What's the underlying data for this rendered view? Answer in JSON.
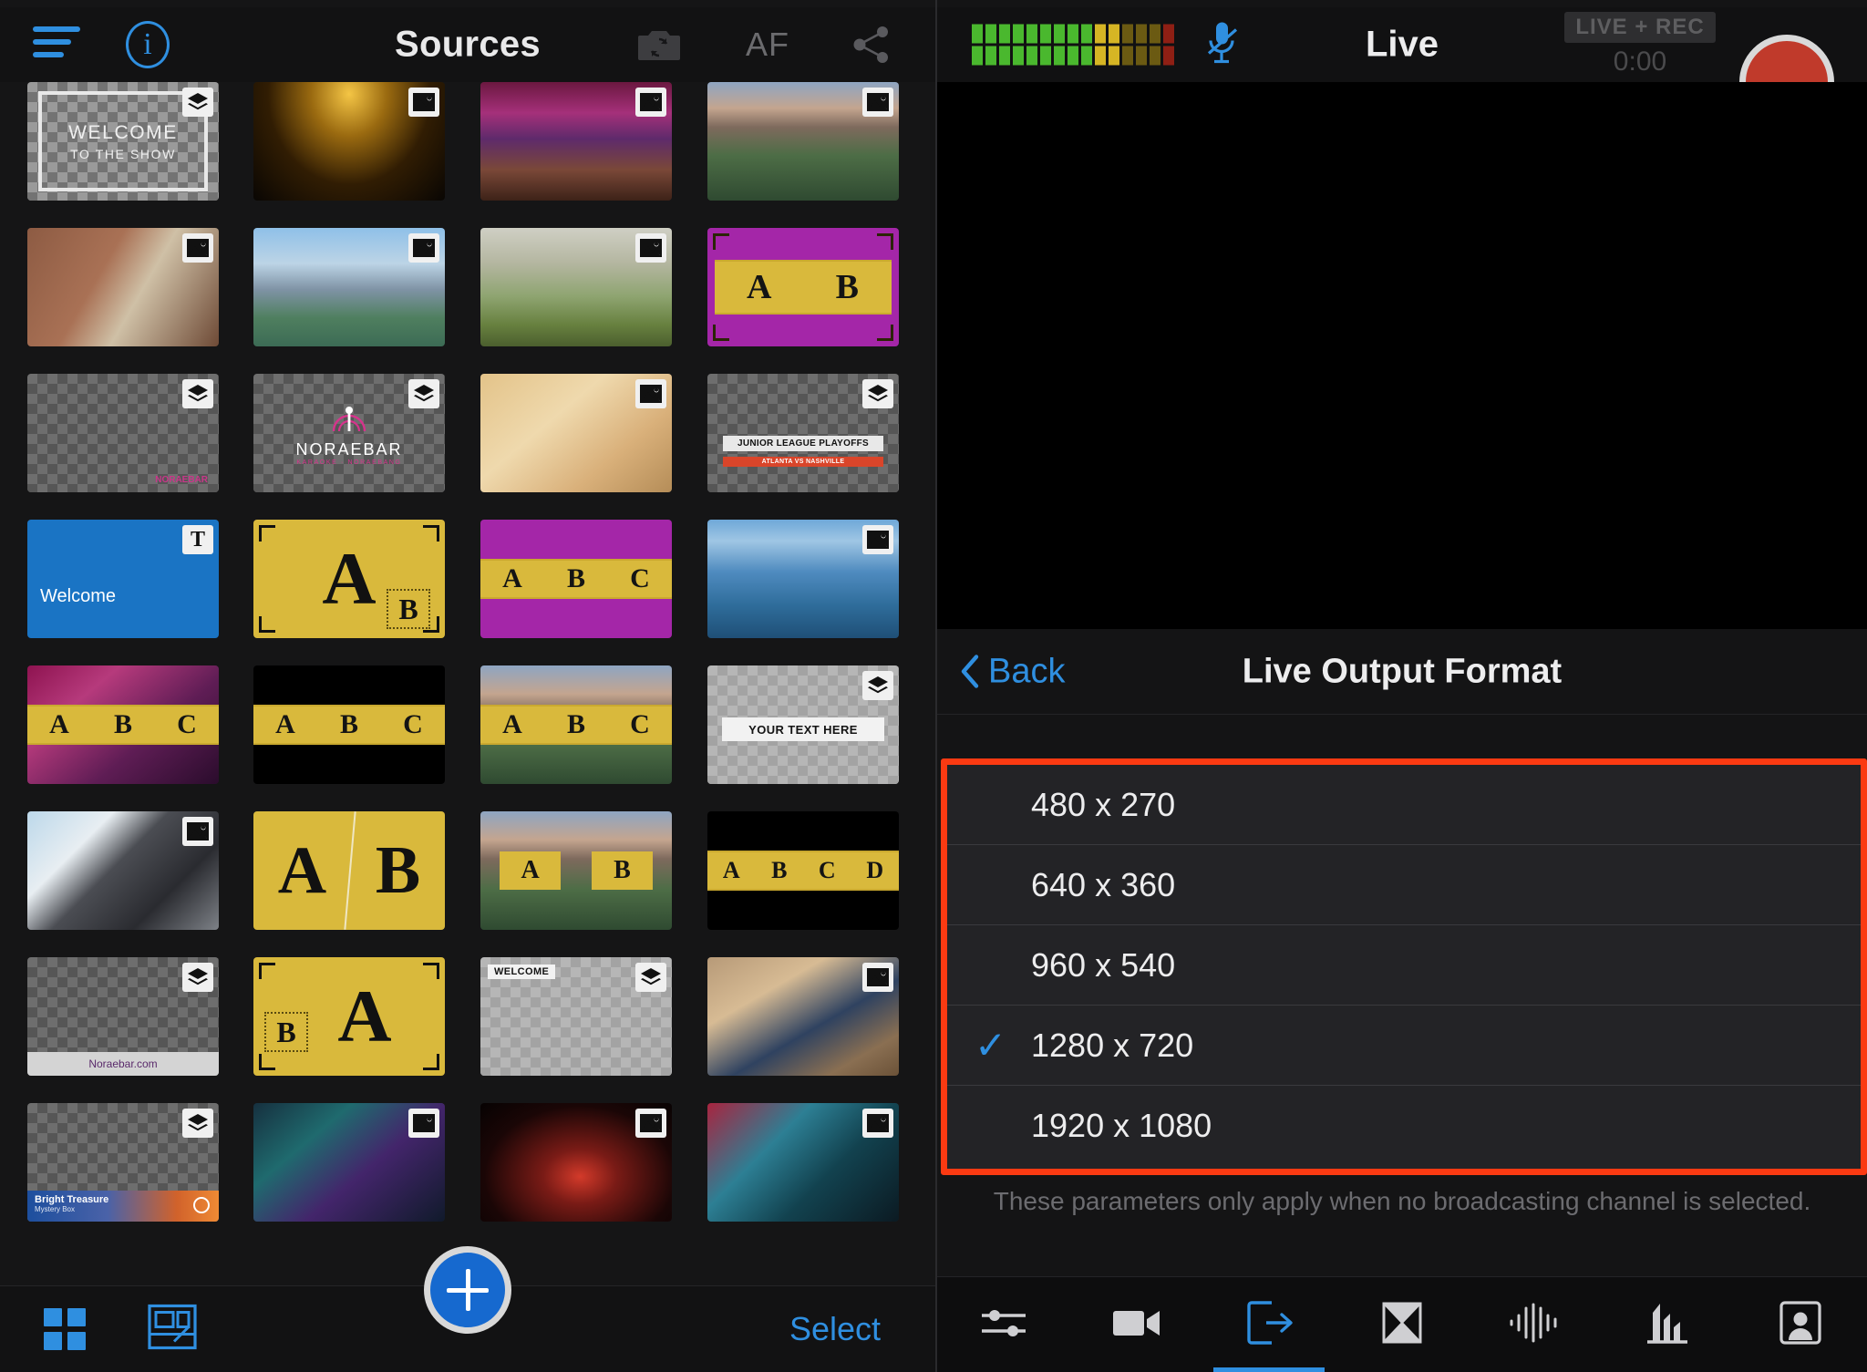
{
  "left": {
    "topbar": {
      "title": "Sources",
      "menu_icon": "hamburger-icon",
      "info_icon": "info-icon",
      "info_glyph": "i",
      "flip_camera_icon": "flip-camera-icon",
      "af_label": "AF",
      "share_icon": "share-icon"
    },
    "bottombar": {
      "grid_view_icon": "grid-view-icon",
      "layout_view_icon": "layout-view-icon",
      "add_icon": "plus-icon",
      "select_label": "Select"
    },
    "grid": {
      "rows": [
        [
          {
            "name": "welcome-to-the-show",
            "badge": "layers",
            "kind": "checker-frame",
            "line1": "WELCOME",
            "line2": "TO THE SHOW"
          },
          {
            "name": "concert-gold",
            "badge": "image",
            "kind": "photo",
            "fill": "ph-concert-gold"
          },
          {
            "name": "crowd-purple",
            "badge": "image",
            "kind": "photo",
            "fill": "ph-crowd"
          },
          {
            "name": "austin-skyline",
            "badge": "image",
            "kind": "photo",
            "fill": "ph-skyline-austin"
          }
        ],
        [
          {
            "name": "brick-building",
            "badge": "image",
            "kind": "photo",
            "fill": "ph-brick"
          },
          {
            "name": "city-river",
            "badge": "image",
            "kind": "photo",
            "fill": "ph-skyline-blue"
          },
          {
            "name": "marsh-landscape",
            "badge": "image",
            "kind": "photo",
            "fill": "ph-marsh"
          },
          {
            "name": "ab-split-purple",
            "badge": "none",
            "kind": "ab2",
            "bg": "#a426a8",
            "letters": [
              "A",
              "B"
            ]
          }
        ],
        [
          {
            "name": "noraebar-watermark",
            "badge": "layers",
            "kind": "checker-plain",
            "caption": "NORAEBAR"
          },
          {
            "name": "noraebar-logo",
            "badge": "layers",
            "kind": "checker-logo",
            "caption": "NORAEBAR",
            "sub": "KARAOKE · NORAEBANG"
          },
          {
            "name": "hummus-dish",
            "badge": "image",
            "kind": "photo",
            "fill": "ph-hummus"
          },
          {
            "name": "junior-league-lower-third",
            "badge": "layers",
            "kind": "lower-third",
            "line1": "JUNIOR LEAGUE PLAYOFFS",
            "line2": "ATLANTA VS NASHVILLE"
          }
        ],
        [
          {
            "name": "welcome-title-card",
            "badge": "text",
            "badge_glyph": "T",
            "kind": "title",
            "bg": "#1a74c4",
            "text": "Welcome"
          },
          {
            "name": "pip-a-b",
            "badge": "none",
            "kind": "pip",
            "bg": "#d9b93c",
            "big": "A",
            "small": "B"
          },
          {
            "name": "abc-band-magenta",
            "badge": "none",
            "kind": "abc",
            "bg": "#a426a8",
            "letters": [
              "A",
              "B",
              "C"
            ]
          },
          {
            "name": "riverwalk-photo",
            "badge": "image",
            "kind": "photo",
            "fill": "ph-riverwalk"
          }
        ],
        [
          {
            "name": "abc-band-silk",
            "badge": "none",
            "kind": "abc",
            "bg": "silk",
            "letters": [
              "A",
              "B",
              "C"
            ]
          },
          {
            "name": "abc-band-black",
            "badge": "none",
            "kind": "abc",
            "bg": "#000000",
            "letters": [
              "A",
              "B",
              "C"
            ]
          },
          {
            "name": "abc-band-cityscape",
            "badge": "none",
            "kind": "abc",
            "bg": "city",
            "letters": [
              "A",
              "B",
              "C"
            ]
          },
          {
            "name": "your-text-here",
            "badge": "layers",
            "kind": "checker-textbox",
            "text": "YOUR TEXT HERE"
          }
        ],
        [
          {
            "name": "mountain-photo",
            "badge": "image",
            "kind": "photo",
            "fill": "ph-mountain"
          },
          {
            "name": "ab-fullscreen-split",
            "badge": "none",
            "kind": "ab-big",
            "bg": "#d9b93c",
            "letters": [
              "A",
              "B"
            ]
          },
          {
            "name": "ab-band-cityscape",
            "badge": "none",
            "kind": "ab2band",
            "bg": "city",
            "letters": [
              "A",
              "B"
            ]
          },
          {
            "name": "abcd-band-black",
            "badge": "none",
            "kind": "abcd",
            "bg": "#000000",
            "letters": [
              "A",
              "B",
              "C",
              "D"
            ]
          }
        ],
        [
          {
            "name": "noraebar-url-bar",
            "badge": "layers",
            "kind": "checker-urlbar",
            "text": "Noraebar.com"
          },
          {
            "name": "pip-b-a",
            "badge": "none",
            "kind": "pip2",
            "bg": "#d9b93c",
            "big": "A",
            "small": "B"
          },
          {
            "name": "welcome-tag",
            "badge": "layers",
            "kind": "checker-tag",
            "text": "WELCOME"
          },
          {
            "name": "family-photo",
            "badge": "image",
            "kind": "photo",
            "fill": "ph-family"
          }
        ],
        [
          {
            "name": "bright-treasure-banner",
            "badge": "layers",
            "kind": "checker-banner",
            "line1": "Bright Treasure",
            "line2": "Mystery Box"
          },
          {
            "name": "stage-teal-photo",
            "badge": "image",
            "kind": "photo",
            "fill": "ph-stage-teal"
          },
          {
            "name": "stage-red-photo",
            "badge": "image",
            "kind": "photo",
            "fill": "ph-stage-red"
          },
          {
            "name": "guitar-stage-photo",
            "badge": "image",
            "kind": "photo",
            "fill": "ph-guitar"
          }
        ]
      ]
    }
  },
  "right": {
    "topbar": {
      "title": "Live",
      "mic_icon": "mic-muted-icon",
      "vu_meter_icon": "audio-level-meter",
      "status_badge": "LIVE + REC",
      "timer": "0:00",
      "record_icon": "record-button"
    },
    "panel": {
      "back_label": "Back",
      "back_icon": "chevron-left-icon",
      "title": "Live Output Format",
      "note": "These parameters only apply when no broadcasting channel is selected.",
      "check_glyph": "✓",
      "options": [
        {
          "label": "480 x 270",
          "selected": false
        },
        {
          "label": "640 x 360",
          "selected": false
        },
        {
          "label": "960 x 540",
          "selected": false
        },
        {
          "label": "1280 x 720",
          "selected": true
        },
        {
          "label": "1920 x 1080",
          "selected": false
        }
      ]
    },
    "tabs": [
      {
        "name": "tab-settings",
        "icon": "sliders-icon",
        "active": false
      },
      {
        "name": "tab-video",
        "icon": "video-camera-icon",
        "active": false
      },
      {
        "name": "tab-output",
        "icon": "output-export-icon",
        "active": true
      },
      {
        "name": "tab-transition",
        "icon": "transition-icon",
        "active": false
      },
      {
        "name": "tab-audio",
        "icon": "audio-waveform-icon",
        "active": false
      },
      {
        "name": "tab-levels",
        "icon": "bar-levels-icon",
        "active": false
      },
      {
        "name": "tab-guest",
        "icon": "guest-person-icon",
        "active": false
      }
    ]
  },
  "colors": {
    "accent_blue": "#2f8fe0",
    "highlight_red": "#fb3a12",
    "record_red": "#c03a2b",
    "template_gold": "#d9b93c",
    "template_magenta": "#a426a8",
    "panel_bg": "#141415",
    "list_bg": "#232326"
  }
}
